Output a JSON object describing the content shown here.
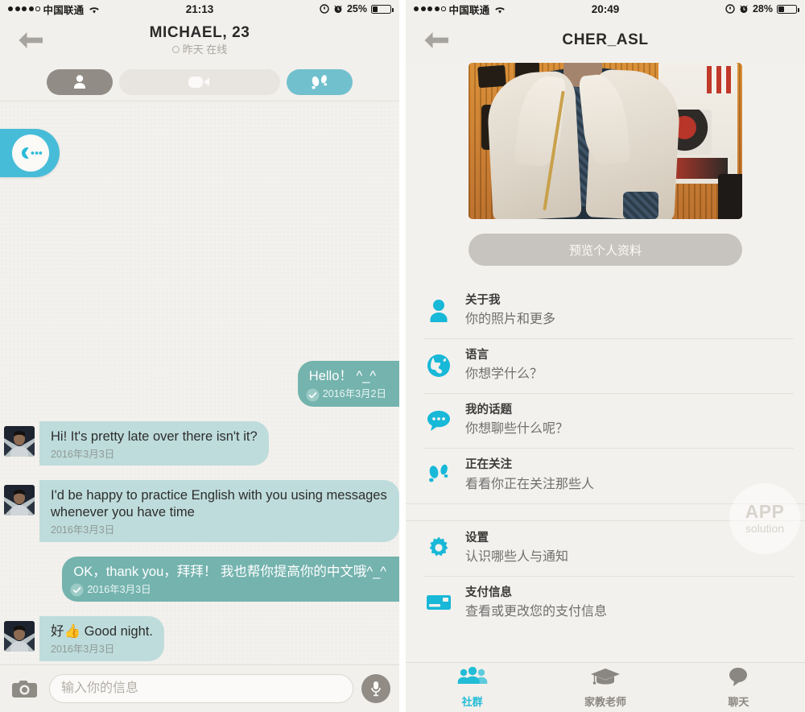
{
  "colors": {
    "accent_cyan": "#22bcd6",
    "accent_teal_button": "#71c0ce",
    "bubble_incoming": "#bedcdb",
    "bubble_outgoing": "#74b3ae",
    "screen_background": "#f3f1ed",
    "gray_pill": "#918c85",
    "preview_button": "#c7c4bf"
  },
  "left_screen": {
    "status_bar": {
      "signal_dots_filled": 4,
      "signal_dots_total": 5,
      "carrier": "中国联通",
      "wifi_icon": "wifi-icon",
      "time": "21:13",
      "location_icon": "location-services-icon",
      "alarm_icon": "alarm-clock-icon",
      "battery_percent": "25%",
      "battery_level": 25
    },
    "nav": {
      "back_icon": "back-arrow-icon",
      "title": "MICHAEL, 23",
      "subtitle": "昨天 在线",
      "status_ring_icon": "online-status-ring-icon"
    },
    "segments": [
      {
        "name": "profile",
        "icon": "person-icon",
        "active": true
      },
      {
        "name": "video",
        "icon": "video-camera-icon",
        "active": false
      },
      {
        "name": "footsteps",
        "icon": "footprints-icon",
        "active": true
      }
    ],
    "floating_button": {
      "icon": "chat-bubble-pacman-icon",
      "label": ""
    },
    "messages": [
      {
        "side": "out",
        "text": "Hello！ ^_^",
        "timestamp": "2016年3月2日",
        "sent_check": true
      },
      {
        "side": "in",
        "avatar": "user-avatar",
        "text": "Hi! It's pretty late over there isn't it?",
        "timestamp": "2016年3月3日",
        "sent_check": false
      },
      {
        "side": "in",
        "avatar": "user-avatar",
        "text": "I'd be happy to practice English with you using messages whenever you have time",
        "timestamp": "2016年3月3日",
        "sent_check": false
      },
      {
        "side": "out",
        "text": "OK，thank you，拜拜！ 我也帮你提高你的中文哦^_^",
        "timestamp": "2016年3月3日",
        "sent_check": true
      },
      {
        "side": "in",
        "avatar": "user-avatar",
        "text": "好👍 Good night.",
        "timestamp": "2016年3月3日",
        "sent_check": false
      }
    ],
    "composer": {
      "camera_icon": "camera-icon",
      "input_value": "",
      "input_placeholder": "输入你的信息",
      "mic_icon": "microphone-icon"
    }
  },
  "right_screen": {
    "status_bar": {
      "signal_dots_filled": 4,
      "signal_dots_total": 5,
      "carrier": "中国联通",
      "wifi_icon": "wifi-icon",
      "time": "20:49",
      "location_icon": "location-services-icon",
      "alarm_icon": "alarm-clock-icon",
      "battery_percent": "28%",
      "battery_level": 28
    },
    "nav": {
      "back_icon": "back-arrow-icon",
      "title": "CHER_ASL"
    },
    "profile_photo": {
      "alt": "profile-photo-woman-in-wool-coat"
    },
    "preview_button": {
      "label": "预览个人资料"
    },
    "menu_items": [
      {
        "icon": "person-icon",
        "title": "关于我",
        "subtitle": "你的照片和更多"
      },
      {
        "icon": "globe-icon",
        "title": "语言",
        "subtitle": "你想学什么？"
      },
      {
        "icon": "speech-bubble-icon",
        "title": "我的话题",
        "subtitle": "你想聊些什么呢？"
      },
      {
        "icon": "footprints-icon",
        "title": "正在关注",
        "subtitle": "看看你正在关注那些人"
      }
    ],
    "menu_items_group2": [
      {
        "icon": "gear-icon",
        "title": "设置",
        "subtitle": "认识哪些人与通知"
      },
      {
        "icon": "credit-card-icon",
        "title": "支付信息",
        "subtitle": "查看或更改您的支付信息"
      }
    ],
    "watermark": {
      "line1": "APP",
      "line2": "solution"
    },
    "tabs": [
      {
        "icon": "people-group-icon",
        "label": "社群",
        "active": true
      },
      {
        "icon": "graduation-cap-icon",
        "label": "家教老师",
        "active": false
      },
      {
        "icon": "chat-bubble-icon",
        "label": "聊天",
        "active": false
      }
    ]
  }
}
